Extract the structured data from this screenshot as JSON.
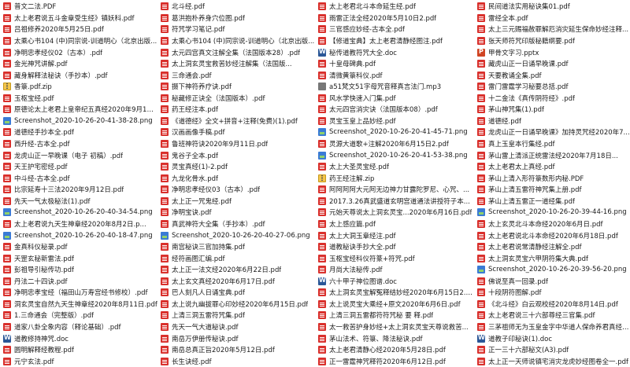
{
  "columns": [
    [
      {
        "name": "普文二法.PDF",
        "type": "pdf"
      },
      {
        "name": "太上老君说五斗金章受生经》镇妖科.pdf",
        "type": "pdf"
      },
      {
        "name": "吕祖修养2020年5月25日.pdf",
        "type": "pdf"
      },
      {
        "name": "太乘心书104 (中)同宗说-训道明心（北京出版...",
        "type": "pdf"
      },
      {
        "name": "净明忠孝经仪02（古本）.pdf",
        "type": "pdf"
      },
      {
        "name": "金光神咒讲解.pdf",
        "type": "pdf"
      },
      {
        "name": "藏身解释法秘诀（手抄本）.pdf",
        "type": "pdf"
      },
      {
        "name": "香箓.pdf.zip",
        "type": "zip"
      },
      {
        "name": "玉枢宝经.pdf",
        "type": "pdf"
      },
      {
        "name": "原德论太上老君上皇帝纪五真经2020年9月17日...",
        "type": "pdf"
      },
      {
        "name": "Screenshot_2020-10-26-20-41-38-28.png",
        "type": "png"
      },
      {
        "name": "道德经手抄本全.pdf",
        "type": "pdf"
      },
      {
        "name": "西升经-古本全.pdf",
        "type": "pdf"
      },
      {
        "name": "龙虎山正一早晚课（电子 初稿）.pdf",
        "type": "pdf"
      },
      {
        "name": "天王护宅密经.pdf",
        "type": "pdf"
      },
      {
        "name": "中斗经-古本全.pdf",
        "type": "pdf"
      },
      {
        "name": "比宗延寿十三法2020年9月12日.pdf",
        "type": "pdf"
      },
      {
        "name": "先天一气太极秘法(1).pdf",
        "type": "pdf"
      },
      {
        "name": "Screenshot_2020-10-26-20-40-34-54.png",
        "type": "png"
      },
      {
        "name": "太上老君说九天生神章经2020年8月2日.p...",
        "type": "pdf"
      },
      {
        "name": "Screenshot_2020-10-26-20-40-18-47.png",
        "type": "png"
      },
      {
        "name": "金真科仪秘录.pdf",
        "type": "pdf"
      },
      {
        "name": "天罡玄秘新雷法.pdf",
        "type": "pdf"
      },
      {
        "name": "彭祖导引秘传功.pdf",
        "type": "pdf"
      },
      {
        "name": "丹法二十四诀.pdf",
        "type": "pdf"
      },
      {
        "name": "净明忠孝宝经（福田山万寿宫经书修校）.pdf",
        "type": "pdf"
      },
      {
        "name": "洞玄灵宝自然九天生神章经2020年8月11日.pdf",
        "type": "pdf"
      },
      {
        "name": "1.三命通会（完整版）.pdf",
        "type": "pdf"
      },
      {
        "name": "道家八卦全象内容（释论基础）.pdf",
        "type": "pdf"
      },
      {
        "name": "道教修持神咒.doc",
        "type": "doc"
      },
      {
        "name": "圆明解释经教程.pdf",
        "type": "pdf"
      },
      {
        "name": "元宁玄法.pdf",
        "type": "pdf"
      }
    ],
    [
      {
        "name": "北斗经.pdf",
        "type": "pdf"
      },
      {
        "name": "葛洪抱朴养身穴位图.pdf",
        "type": "pdf"
      },
      {
        "name": "符咒学习笔记.pdf",
        "type": "pdf"
      },
      {
        "name": "太乘心书104 (中)同宗说-训道明心（北京出版...",
        "type": "pdf"
      },
      {
        "name": "太元四宫真文注解全集（法国版本28）.pdf",
        "type": "pdf"
      },
      {
        "name": "太上洞玄灵宝救苦妙经注解集（法国版...",
        "type": "pdf"
      },
      {
        "name": "三命通会.pdf",
        "type": "pdf"
      },
      {
        "name": "摄下神符养疗诀.pdf",
        "type": "pdf"
      },
      {
        "name": "秘藏修正诀全（法国版本）.pdf",
        "type": "pdf"
      },
      {
        "name": "药王经注本.pdf",
        "type": "pdf"
      },
      {
        "name": "《道德经》全文+拼音+注释(免费)(1).pdf",
        "type": "pdf"
      },
      {
        "name": "汉画画像手稿.pdf",
        "type": "pdf"
      },
      {
        "name": "鲁班神符诀2020年9月11日.pdf",
        "type": "pdf"
      },
      {
        "name": "鬼谷子全本.pdf",
        "type": "pdf"
      },
      {
        "name": "灵宝真经(1)-2.pdf",
        "type": "pdf"
      },
      {
        "name": "九龙化骨水.pdf",
        "type": "pdf"
      },
      {
        "name": "净明忠孝经仪03（古本）.pdf",
        "type": "pdf"
      },
      {
        "name": "太上正一咒鬼经.pdf",
        "type": "pdf"
      },
      {
        "name": "净明宝诀.pdf",
        "type": "pdf"
      },
      {
        "name": "真武神符大全集（手抄本）.pdf",
        "type": "pdf"
      },
      {
        "name": "Screenshot_2020-10-26-20-40-27-06.png",
        "type": "png"
      },
      {
        "name": "南宫秘诀三官加持集.pdf",
        "type": "pdf"
      },
      {
        "name": "经符画图汇编.pdf",
        "type": "pdf"
      },
      {
        "name": "太上正一法文经2020年6月22日.pdf",
        "type": "pdf"
      },
      {
        "name": "太上玄文真经2020年6月17日.pdf",
        "type": "pdf"
      },
      {
        "name": "巴人刻凡人日诵宝典.pdf",
        "type": "pdf"
      },
      {
        "name": "太上说九幽拔罪心印妙经2020年6月15日.pdf",
        "type": "pdf"
      },
      {
        "name": "上清三洞五雷符咒集.pdf",
        "type": "pdf"
      },
      {
        "name": "先天一气大道秘诀.pdf",
        "type": "pdf"
      },
      {
        "name": "南岳万伊册传秘诀.pdf",
        "type": "pdf"
      },
      {
        "name": "南岳总真正旨2020年5月12日.pdf",
        "type": "pdf"
      },
      {
        "name": "长生诀经.pdf",
        "type": "pdf"
      }
    ],
    [
      {
        "name": "太上老君北斗本命延生经.pdf",
        "type": "pdf"
      },
      {
        "name": "雨雷正法全经2020年5月10日2.pdf",
        "type": "pdf"
      },
      {
        "name": "三官感应妙经-古本全.pdf",
        "type": "pdf"
      },
      {
        "name": "【修道宝典】太上老君清静经图注.pdf",
        "type": "pdf"
      },
      {
        "name": "秘传道教符咒大全.doc",
        "type": "doc"
      },
      {
        "name": "十皇母碑典.pdf",
        "type": "pdf"
      },
      {
        "name": "清微黄箓科仪.pdf",
        "type": "pdf"
      },
      {
        "name": "a51梵文51字母咒音释真言法门.mp3",
        "type": "other"
      },
      {
        "name": "风水学快速入门集.pdf",
        "type": "pdf"
      },
      {
        "name": "太元四宫消灾诀（法国版本08）.pdf",
        "type": "pdf"
      },
      {
        "name": "灵宝玉皇上品妙经.pdf",
        "type": "pdf"
      },
      {
        "name": "Screenshot_2020-10-26-20-41-45-71.png",
        "type": "png"
      },
      {
        "name": "灵源大道歌+注解2020年6月15日2.pdf",
        "type": "pdf"
      },
      {
        "name": "Screenshot_2020-10-26-20-41-53-38.png",
        "type": "png"
      },
      {
        "name": "太上大圣灵宝经.pdf",
        "type": "pdf"
      },
      {
        "name": "药王经注解.zip",
        "type": "zip"
      },
      {
        "name": "阿阿阿阿大元阿无边神力甘露陀罗尼、心咒、...",
        "type": "pdf"
      },
      {
        "name": "2017.3.26真武盛道玄明宫道通法讲授符子本...",
        "type": "pdf"
      },
      {
        "name": "元始天尊说太上洞玄灵宝...2020年6月16日.pdf",
        "type": "pdf"
      },
      {
        "name": "太上感应篇.pdf",
        "type": "pdf"
      },
      {
        "name": "太上大洞玉章经注.pdf",
        "type": "pdf"
      },
      {
        "name": "道教秘诀手抄大全.pdf",
        "type": "pdf"
      },
      {
        "name": "玉枢宝经科仪符篆+符咒.pdf",
        "type": "pdf"
      },
      {
        "name": "月尚大法秘传.pdf",
        "type": "pdf"
      },
      {
        "name": "六十甲子神位图谱.doc",
        "type": "doc"
      },
      {
        "name": "太上洞玄灵宝解冤释结妙经2020年6月15日2.pdf",
        "type": "pdf"
      },
      {
        "name": "太上说灵宝大乘经+原文2020年6月6日.pdf",
        "type": "pdf"
      },
      {
        "name": "上清三洞五雷都符符咒秘 要 释.pdf",
        "type": "pdf"
      },
      {
        "name": "太一救苦护身妙经+太上洞玄灵宝天尊说救苦...",
        "type": "pdf"
      },
      {
        "name": "茅山法术、符箓、降法秘诀.pdf",
        "type": "pdf"
      },
      {
        "name": "太上老君清静心经2020年5月28日.pdf",
        "type": "pdf"
      },
      {
        "name": "正一雷霆神咒释符2020年6月12日.pdf",
        "type": "pdf"
      }
    ],
    [
      {
        "name": "民间道法实用秘诀集01.pdf",
        "type": "pdf"
      },
      {
        "name": "雷经全本.pdf",
        "type": "pdf"
      },
      {
        "name": "太上三元赐福赦罪解厄消灾延生保命妙经注释...",
        "type": "pdf"
      },
      {
        "name": "张天师符咒印版秘籍纲要.pdf",
        "type": "pdf"
      },
      {
        "name": "甲骨文字习.pptx",
        "type": "pptx"
      },
      {
        "name": "藏虎山正一日诵早晚课.pdf",
        "type": "pdf"
      },
      {
        "name": "天要教诵全集.pdf",
        "type": "pdf"
      },
      {
        "name": "雷门雷霆学习秘要总括.pdf",
        "type": "pdf"
      },
      {
        "name": "十二金法《真传阴符经》.pdf",
        "type": "pdf"
      },
      {
        "name": "茅山神咒集(1).pdf",
        "type": "pdf"
      },
      {
        "name": "道德经.pdf",
        "type": "pdf"
      },
      {
        "name": "龙虎山正一日诵早晚课》加持灵咒经2020年7...",
        "type": "pdf"
      },
      {
        "name": "真上玉皇本行集经.pdf",
        "type": "pdf"
      },
      {
        "name": "茅山雷上清派正统雷法经2020年7月18日...",
        "type": "pdf"
      },
      {
        "name": "太上老君太上真经.pdf",
        "type": "pdf"
      },
      {
        "name": "茅山上清入形符箓数形内秘.PDF",
        "type": "pdf"
      },
      {
        "name": "茅山上清五雷符神咒集上册.pdf",
        "type": "pdf"
      },
      {
        "name": "茅山上清五雷正一道经集.pdf",
        "type": "pdf"
      },
      {
        "name": "Screenshot_2020-10-26-20-39-44-16.png",
        "type": "png"
      },
      {
        "name": "太上玄灵北斗本命经2020年6月日.pdf",
        "type": "pdf"
      },
      {
        "name": "太上老君说北斗本命经2020年6月18日.pdf",
        "type": "pdf"
      },
      {
        "name": "太上老君说常清静经注解全.pdf",
        "type": "pdf"
      },
      {
        "name": "太上洞玄灵宝六甲阴符集大典.pdf",
        "type": "pdf"
      },
      {
        "name": "Screenshot_2020-10-26-20-39-56-20.png",
        "type": "png"
      },
      {
        "name": "佛说至真一回录.pdf",
        "type": "pdf"
      },
      {
        "name": "十段阴符图解.pdf",
        "type": "pdf"
      },
      {
        "name": "《北斗经》白云观校经2020年8月14日.pdf",
        "type": "pdf"
      },
      {
        "name": "太上老君说三十六部尊经三官集.pdf",
        "type": "pdf"
      },
      {
        "name": "三茅祖师无为玉皇金字中华道人保命养君真经.pdf",
        "type": "pdf"
      },
      {
        "name": "道教子印秘诀(1).doc",
        "type": "doc"
      },
      {
        "name": "正一三十六部秘文(A3).pdf",
        "type": "pdf"
      },
      {
        "name": "太上正一天师说镇宅消灾龙虎妙经图卷全一.pdf",
        "type": "pdf"
      }
    ]
  ]
}
